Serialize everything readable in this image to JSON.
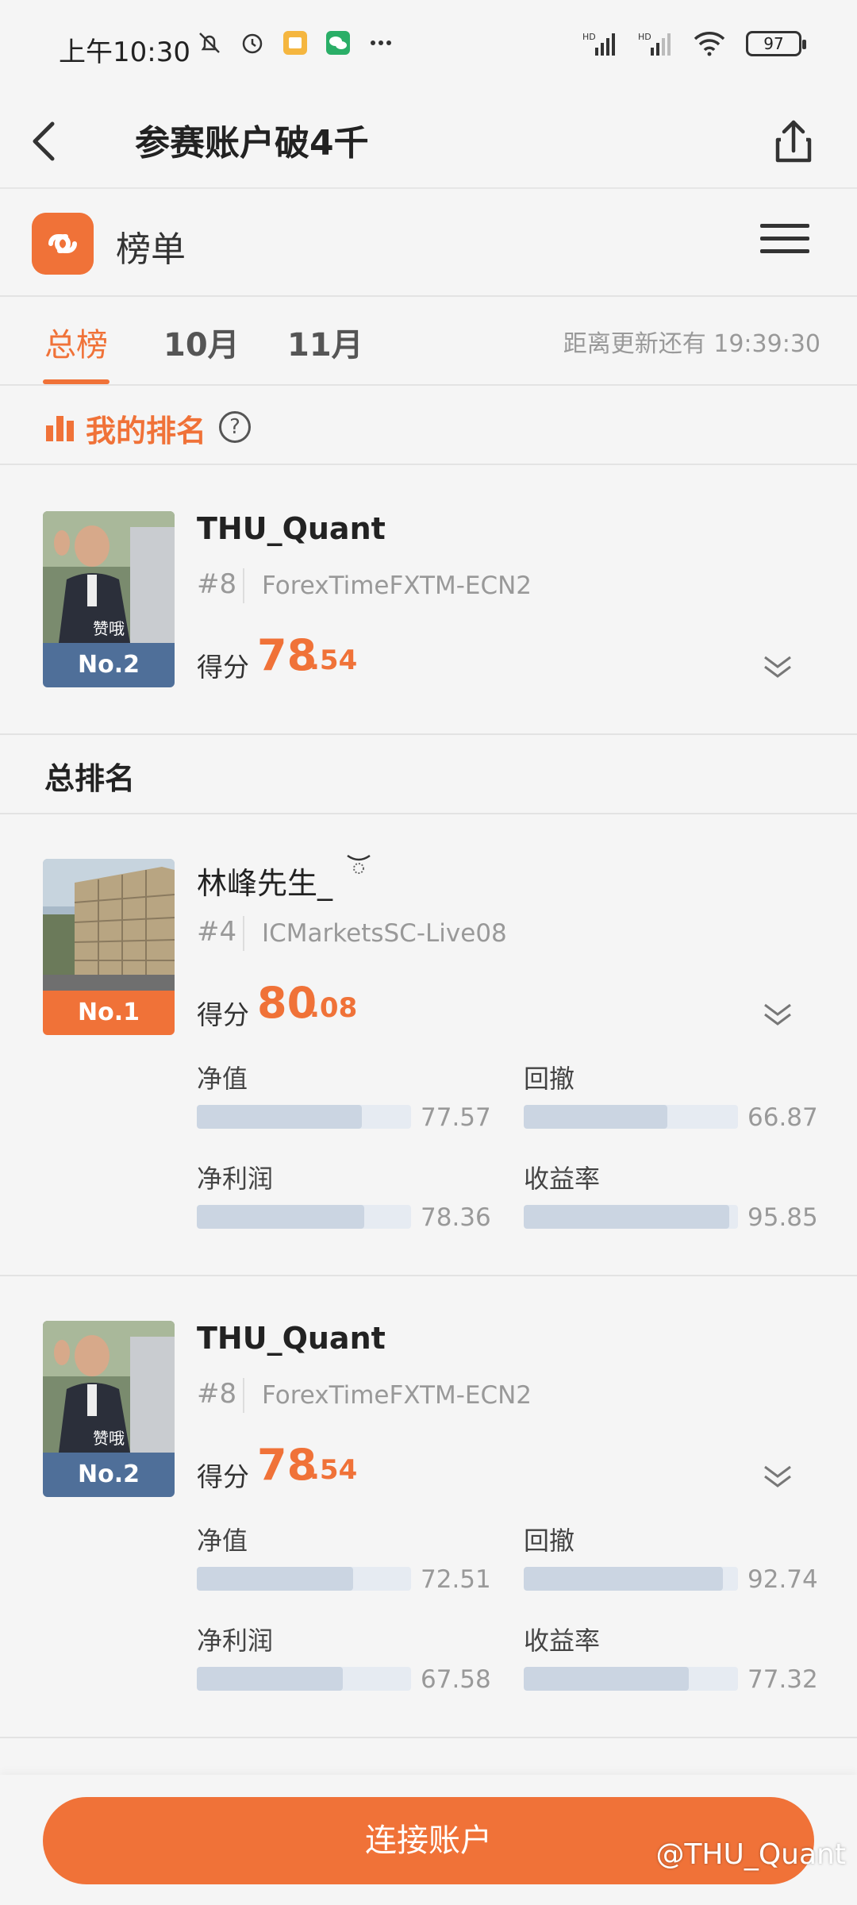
{
  "status_bar": {
    "time": "上午10:30",
    "battery": "97",
    "icons": [
      "bell-off-icon",
      "alarm-icon",
      "notes-app-icon",
      "wechat-icon",
      "more-dots-icon",
      "hd-signal-icon",
      "hd-signal-icon",
      "wifi-icon",
      "battery-icon"
    ]
  },
  "nav": {
    "title": "参赛账户破4千"
  },
  "app": {
    "name": "榜单",
    "brand_color": "#f07238"
  },
  "tabs": {
    "items": [
      {
        "label": "总榜",
        "active": true
      },
      {
        "label": "10月",
        "active": false
      },
      {
        "label": "11月",
        "active": false
      }
    ],
    "countdown": "距离更新还有 19:39:30"
  },
  "my_rank": {
    "title": "我的排名",
    "help": "?",
    "entry": {
      "name": "THU_Quant",
      "rank": "#8",
      "server": "ForexTimeFXTM-ECN2",
      "score_label": "得分",
      "score_int": "78",
      "score_dec": ".54",
      "badge": "No.2",
      "caption": "赞哦"
    }
  },
  "overall": {
    "title": "总排名",
    "entries": [
      {
        "name": "林峰先生_",
        "rank": "#4",
        "server": "ICMarketsSC-Live08",
        "score_label": "得分",
        "score_int": "80",
        "score_dec": ".08",
        "badge": "No.1",
        "metrics": [
          {
            "label": "净值",
            "value": "77.57",
            "fill": 0.77
          },
          {
            "label": "回撤",
            "value": "66.87",
            "fill": 0.67
          },
          {
            "label": "净利润",
            "value": "78.36",
            "fill": 0.78
          },
          {
            "label": "收益率",
            "value": "95.85",
            "fill": 0.96
          }
        ]
      },
      {
        "name": "THU_Quant",
        "rank": "#8",
        "server": "ForexTimeFXTM-ECN2",
        "score_label": "得分",
        "score_int": "78",
        "score_dec": ".54",
        "badge": "No.2",
        "caption": "赞哦",
        "metrics": [
          {
            "label": "净值",
            "value": "72.51",
            "fill": 0.73
          },
          {
            "label": "回撤",
            "value": "92.74",
            "fill": 0.93
          },
          {
            "label": "净利润",
            "value": "67.58",
            "fill": 0.68
          },
          {
            "label": "收益率",
            "value": "77.32",
            "fill": 0.77
          }
        ]
      }
    ]
  },
  "bottom": {
    "connect_label": "连接账户",
    "watermark": "@THU_Quant"
  }
}
